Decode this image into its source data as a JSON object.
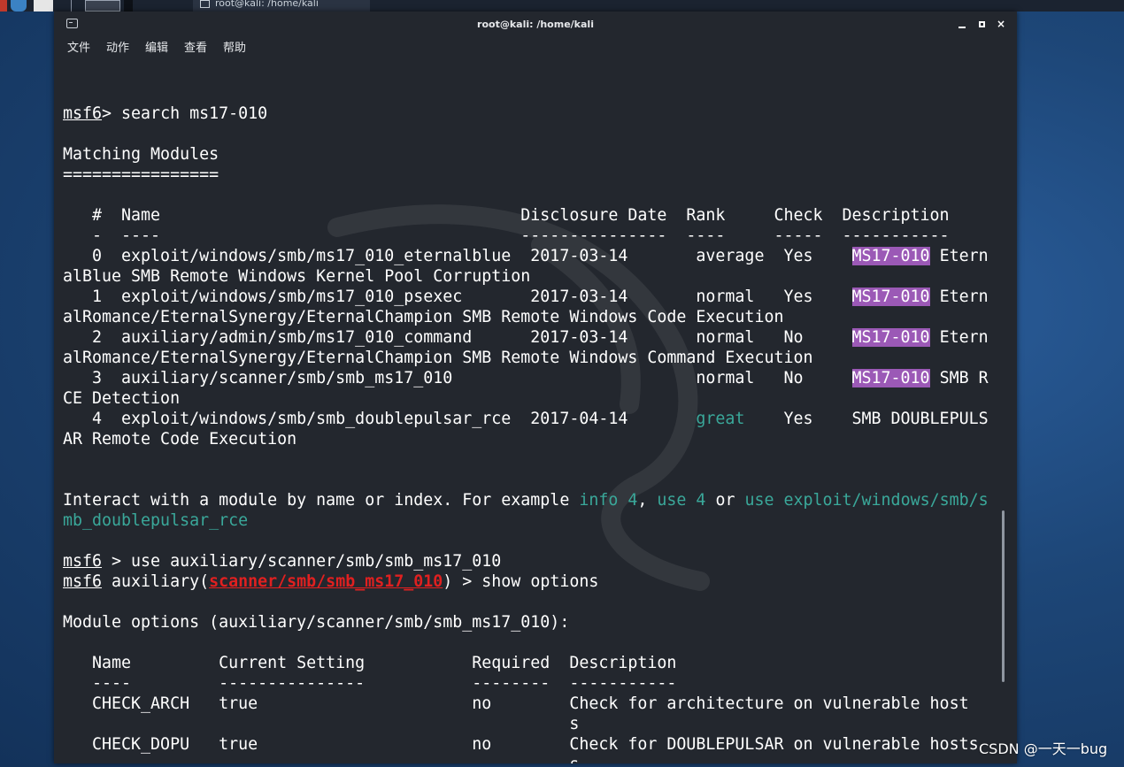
{
  "taskbar": {
    "task_label": "root@kali: /home/kali"
  },
  "window": {
    "title": "root@kali: /home/kali",
    "menu": [
      "文件",
      "动作",
      "编辑",
      "查看",
      "帮助"
    ],
    "controls": {
      "minimize": "minimize-icon",
      "maximize": "maximize-icon",
      "close": "×"
    }
  },
  "terminal": {
    "lines": [
      "",
      [
        [
          "u",
          "msf6"
        ],
        [
          "",
          "> search ms17-010"
        ]
      ],
      "",
      "Matching Modules",
      "================",
      "",
      "   #  Name                                     Disclosure Date  Rank     Check  Description",
      "   -  ----                                     ---------------  ----     -----  -----------",
      [
        [
          "",
          "   0  exploit/windows/smb/ms17_010_eternalblue  2017-03-14       average  Yes    "
        ],
        [
          "hl",
          "MS17-010"
        ],
        [
          "",
          " Etern"
        ]
      ],
      "alBlue SMB Remote Windows Kernel Pool Corruption",
      [
        [
          "",
          "   1  exploit/windows/smb/ms17_010_psexec       2017-03-14       normal   Yes    "
        ],
        [
          "hl",
          "MS17-010"
        ],
        [
          "",
          " Etern"
        ]
      ],
      "alRomance/EternalSynergy/EternalChampion SMB Remote Windows Code Execution",
      [
        [
          "",
          "   2  auxiliary/admin/smb/ms17_010_command      2017-03-14       normal   No     "
        ],
        [
          "hl",
          "MS17-010"
        ],
        [
          "",
          " Etern"
        ]
      ],
      "alRomance/EternalSynergy/EternalChampion SMB Remote Windows Command Execution",
      [
        [
          "",
          "   3  auxiliary/scanner/smb/smb_ms17_010                         normal   No     "
        ],
        [
          "hl",
          "MS17-010"
        ],
        [
          "",
          " SMB R"
        ]
      ],
      "CE Detection",
      [
        [
          "",
          "   4  exploit/windows/smb/smb_doublepulsar_rce  2017-04-14       "
        ],
        [
          "grn",
          "great"
        ],
        [
          "",
          "    Yes    SMB DOUBLEPULS"
        ]
      ],
      "AR Remote Code Execution",
      "",
      "",
      [
        [
          "",
          "Interact with a module by name or index. For example "
        ],
        [
          "grn",
          "info 4"
        ],
        [
          "",
          ", "
        ],
        [
          "grn",
          "use 4"
        ],
        [
          "",
          " or "
        ],
        [
          "grn",
          "use exploit/windows/smb/s"
        ]
      ],
      [
        [
          "grn",
          "mb_doublepulsar_rce"
        ]
      ],
      "",
      [
        [
          "u",
          "msf6"
        ],
        [
          "",
          " > use auxiliary/scanner/smb/smb_ms17_010"
        ]
      ],
      [
        [
          "u",
          "msf6"
        ],
        [
          "",
          " auxiliary("
        ],
        [
          "red",
          "scanner/smb/smb_ms17_010"
        ],
        [
          "",
          ") > show options"
        ]
      ],
      "",
      "Module options (auxiliary/scanner/smb/smb_ms17_010):",
      "",
      "   Name         Current Setting           Required  Description",
      "   ----         ---------------           --------  -----------",
      "   CHECK_ARCH   true                      no        Check for architecture on vulnerable host",
      "                                                    s",
      "   CHECK_DOPU   true                      no        Check for DOUBLEPULSAR on vulnerable hosts",
      "                                                    s"
    ]
  },
  "watermark_text": "CSDN @一天一bug",
  "colors": {
    "terminal_bg": "#23272e",
    "highlight": "#9b59b6",
    "green": "#3aa89a",
    "red": "#e02020"
  }
}
